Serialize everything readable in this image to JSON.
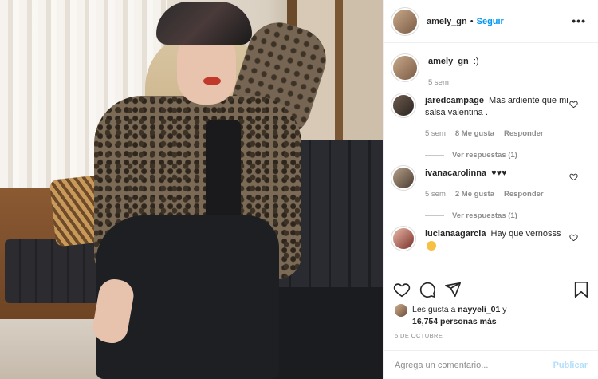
{
  "post": {
    "author": "amely_gn",
    "follow_label": "Seguir",
    "separator": "•",
    "more_label": "•••",
    "caption": {
      "username": "amely_gn",
      "text": ":)",
      "time": "5 sem"
    }
  },
  "comments": [
    {
      "username": "jaredcampage",
      "text": "Mas ardiente que mi salsa valentina .",
      "time": "5 sem",
      "likes": "8 Me gusta",
      "reply_label": "Responder",
      "view_replies": "Ver respuestas (1)"
    },
    {
      "username": "ivanacarolinna",
      "text": "♥♥♥",
      "time": "5 sem",
      "likes": "2 Me gusta",
      "reply_label": "Responder",
      "view_replies": "Ver respuestas (1)"
    },
    {
      "username": "lucianaagarcia",
      "text": "Hay que vernosss",
      "emoji": "smiling-face-with-hearts"
    }
  ],
  "likes": {
    "prefix": "Les gusta a",
    "user": "nayyeli_01",
    "connector": "y",
    "count": "16,754 personas más"
  },
  "date": "5 DE OCTUBRE",
  "comment_input": {
    "placeholder": "Agrega un comentario...",
    "submit_label": "Publicar"
  },
  "colors": {
    "link": "#0095f6",
    "publish_disabled": "#b2dffc",
    "muted": "#8e8e8e",
    "text": "#262626"
  }
}
